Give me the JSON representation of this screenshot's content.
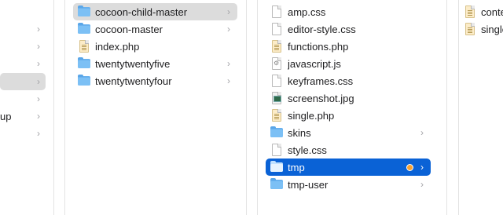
{
  "column1": {
    "items": [
      {
        "label": "",
        "has_children": true
      },
      {
        "label": "",
        "has_children": true
      },
      {
        "label": "",
        "has_children": true
      },
      {
        "label": "",
        "has_children": true,
        "selected": true
      },
      {
        "label": "",
        "has_children": true
      },
      {
        "label": "up",
        "has_children": true
      },
      {
        "label": "",
        "has_children": true
      }
    ]
  },
  "column2": {
    "items": [
      {
        "label": "cocoon-child-master",
        "type": "folder",
        "has_children": true,
        "selected": true
      },
      {
        "label": "cocoon-master",
        "type": "folder",
        "has_children": true
      },
      {
        "label": "index.php",
        "type": "php",
        "has_children": false
      },
      {
        "label": "twentytwentyfive",
        "type": "folder",
        "has_children": true
      },
      {
        "label": "twentytwentyfour",
        "type": "folder",
        "has_children": true
      }
    ]
  },
  "column3": {
    "items": [
      {
        "label": "amp.css",
        "type": "file"
      },
      {
        "label": "editor-style.css",
        "type": "file"
      },
      {
        "label": "functions.php",
        "type": "php"
      },
      {
        "label": "javascript.js",
        "type": "js"
      },
      {
        "label": "keyframes.css",
        "type": "file"
      },
      {
        "label": "screenshot.jpg",
        "type": "image"
      },
      {
        "label": "single.php",
        "type": "php"
      },
      {
        "label": "skins",
        "type": "folder",
        "has_children": true
      },
      {
        "label": "style.css",
        "type": "file"
      },
      {
        "label": "tmp",
        "type": "folder",
        "has_children": true,
        "active": true,
        "tag_color": "#f7a233"
      },
      {
        "label": "tmp-user",
        "type": "folder",
        "has_children": true
      }
    ]
  },
  "column4": {
    "items": [
      {
        "label": "conte",
        "type": "php"
      },
      {
        "label": "single",
        "type": "php"
      }
    ]
  },
  "glyphs": {
    "chevron": "›"
  }
}
